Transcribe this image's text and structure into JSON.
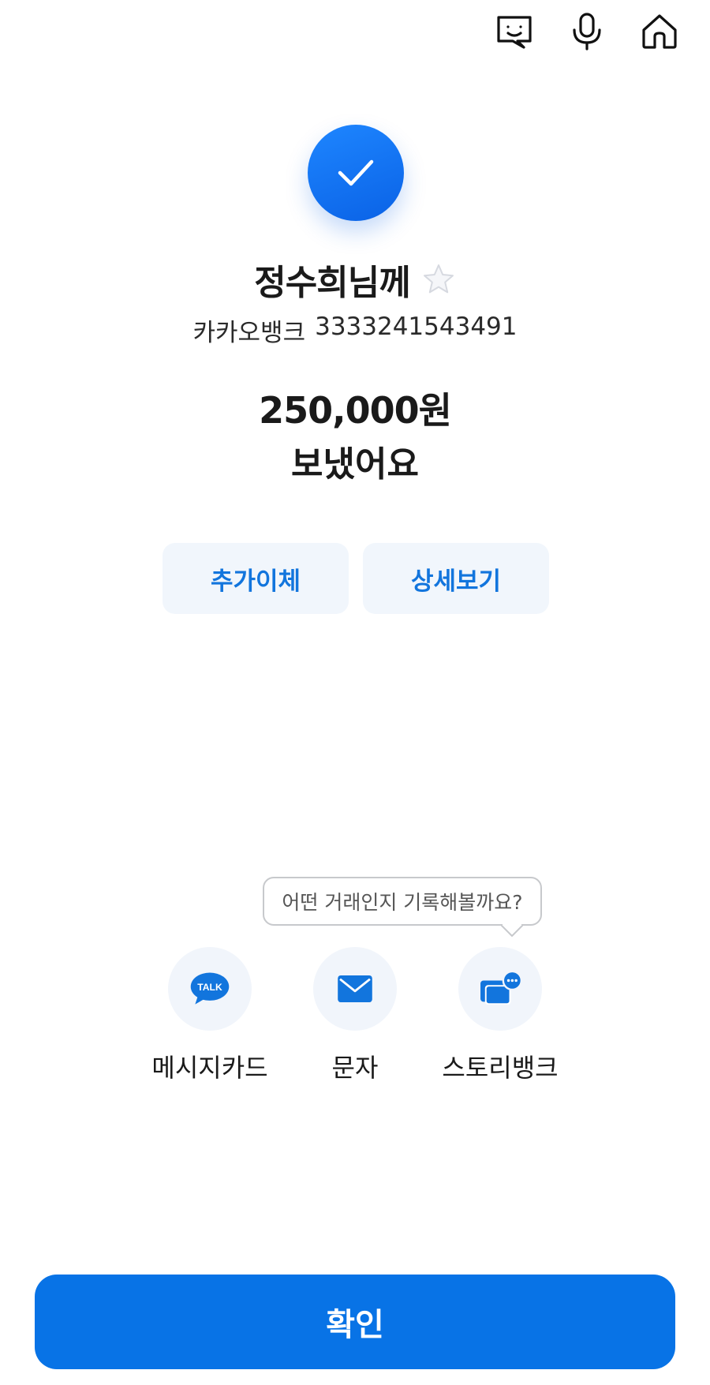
{
  "header": {
    "icons": [
      "chat-bot-icon",
      "microphone-icon",
      "home-icon"
    ]
  },
  "result": {
    "recipient": "정수희님께",
    "bank": "카카오뱅크",
    "account_number": "3333241543491",
    "amount": "250,000원",
    "status_text": "보냈어요"
  },
  "actions": {
    "extra_transfer": "추가이체",
    "details": "상세보기"
  },
  "tooltip": {
    "text": "어떤 거래인지 기록해볼까요?"
  },
  "share": {
    "message_card": "메시지카드",
    "message_card_icon_text": "TALK",
    "sms": "문자",
    "story_bank": "스토리뱅크"
  },
  "confirm": {
    "label": "확인"
  },
  "colors": {
    "accent": "#0873e6",
    "button_bg": "#f1f6fc",
    "button_text": "#1275dd"
  }
}
